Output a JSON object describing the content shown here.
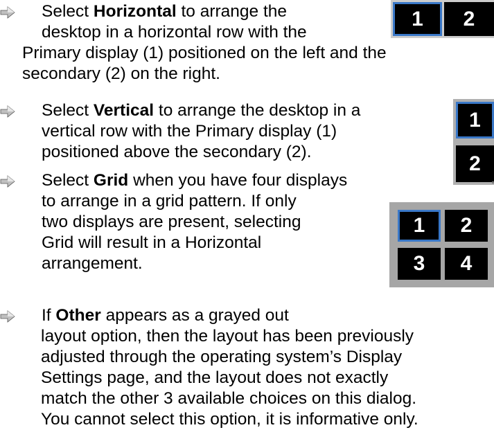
{
  "items": [
    {
      "bold_word": "Horizontal",
      "lead": "Select ",
      "line1_after": " to arrange the",
      "line2": "desktop in a horizontal row with the",
      "line3": "Primary display (1) positioned on the left and the",
      "line4": "secondary (2) on the right."
    },
    {
      "bold_word": "Vertical",
      "lead": "Select ",
      "line1_after": " to arrange the desktop in a",
      "line2": "vertical row with the Primary display (1)",
      "line3": "positioned above the secondary (2)."
    },
    {
      "bold_word": "Grid",
      "lead": "Select ",
      "line1_after": " when you have four displays",
      "line2": "to arrange in a grid pattern. If only",
      "line3": "two displays are present, selecting",
      "line4": "Grid will result in a Horizontal",
      "line5": "arrangement."
    },
    {
      "bold_word": "Other",
      "lead": "If ",
      "line1_after": " appears as a grayed out",
      "line2": "layout option, then the layout has been previously",
      "line3": "adjusted through the operating system’s Display",
      "line4": "Settings page, and the layout does not exactly",
      "line5": "match the other 3 available choices on this dialog.",
      "line6": "You cannot select this option, it is informative only."
    }
  ],
  "thumbnails": {
    "horizontal": [
      "1",
      "2"
    ],
    "vertical": [
      "1",
      "2"
    ],
    "grid": [
      "1",
      "2",
      "3",
      "4"
    ]
  },
  "colors": {
    "tile": "#000000",
    "tile_text": "#ffffff",
    "selected_border": "#3a78c8",
    "bullet_arrow": "#b8b8b8"
  },
  "icons": {
    "bullet": "right-arrow-bullet-icon"
  }
}
